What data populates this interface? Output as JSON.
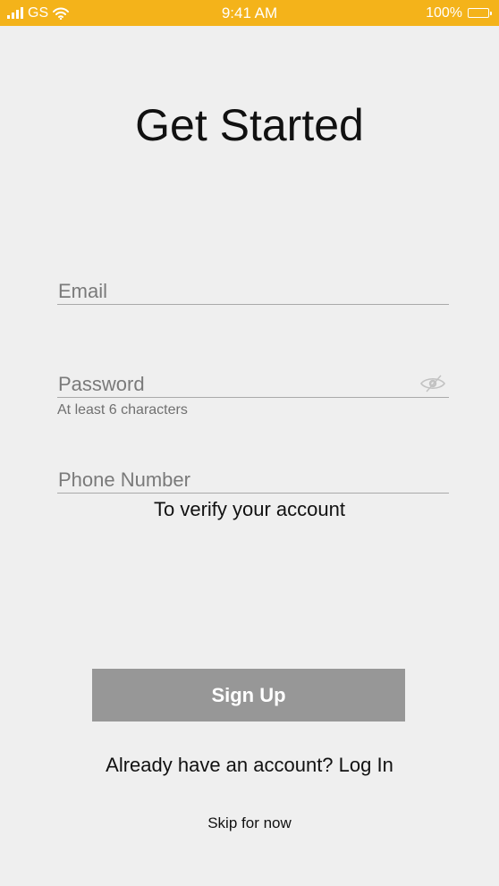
{
  "status_bar": {
    "carrier": "GS",
    "time": "9:41 AM",
    "battery": "100%",
    "background_color": "#f4b31a",
    "icons": [
      "signal-icon",
      "wifi-icon",
      "battery-icon"
    ]
  },
  "title": "Get Started",
  "form": {
    "email": {
      "placeholder": "Email",
      "value": ""
    },
    "password": {
      "placeholder": "Password",
      "value": "",
      "hint": "At least 6 characters",
      "toggle_icon": "eye-icon"
    },
    "phone": {
      "placeholder": "Phone Number",
      "value": "",
      "hint": "To verify your account"
    }
  },
  "signup_button": {
    "label": "Sign Up",
    "color": "#979797"
  },
  "login_prompt": {
    "text": "Already have an account?",
    "link": "Log In"
  },
  "skip_label": "Skip for now"
}
